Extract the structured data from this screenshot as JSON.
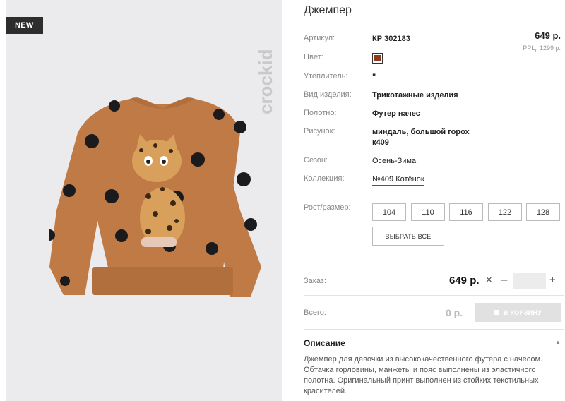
{
  "product": {
    "badge": "NEW",
    "brand_logo": "crockid",
    "title": "Джемпер",
    "price": "649 р.",
    "rrp": "РРЦ: 1299 р."
  },
  "attributes": {
    "article_label": "Артикул:",
    "article_value": "КР 302183",
    "color_label": "Цвет:",
    "color_value": "#8b3a22",
    "insulation_label": "Утеплитель:",
    "insulation_value": "\"",
    "type_label": "Вид изделия:",
    "type_value": "Трикотажные изделия",
    "fabric_label": "Полотно:",
    "fabric_value": "Футер начес",
    "print_label": "Рисунок:",
    "print_value": "миндаль, большой горох к409",
    "season_label": "Сезон:",
    "season_value": "Осень-Зима",
    "collection_label": "Коллекция:",
    "collection_value": "№409 Котёнок"
  },
  "sizes": {
    "label": "Рост/размер:",
    "options": [
      "104",
      "110",
      "116",
      "122",
      "128"
    ],
    "select_all": "ВЫБРАТЬ ВСЕ"
  },
  "order": {
    "label": "Заказ:",
    "price": "649 р.",
    "times": "×",
    "minus": "–",
    "plus": "+",
    "quantity": ""
  },
  "total": {
    "label": "Всего:",
    "value": "0 р.",
    "cart_button": "В КОРЗИНУ"
  },
  "description": {
    "title": "Описание",
    "text": "Джемпер для девочки из высококачественного футера с начесом. Обтачка горловины, манжеты и пояс выполнены из эластичного полотна. Оригинальный принт выполнен из стойких текстильных красителей."
  },
  "colors": {
    "sweater": "#c07a45",
    "dots": "#1b1a1c",
    "swatch": "#8b3a22"
  }
}
